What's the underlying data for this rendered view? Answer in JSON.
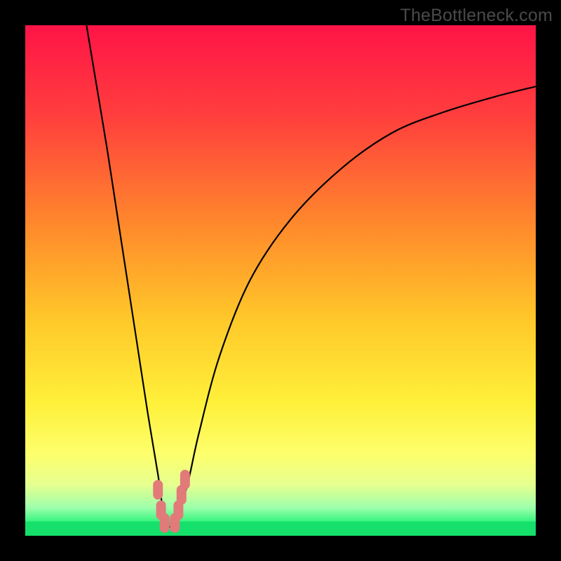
{
  "watermark": "TheBottleneck.com",
  "accent_colors": {
    "marker": "#e27a7a",
    "curve": "#000000",
    "green": "#14e06b"
  },
  "chart_data": {
    "type": "line",
    "title": "",
    "xlabel": "",
    "ylabel": "",
    "xlim": [
      0,
      100
    ],
    "ylim": [
      0,
      100
    ],
    "gradient_stops": [
      {
        "pos": 0.0,
        "color": "#ff1447"
      },
      {
        "pos": 0.18,
        "color": "#ff3f3d"
      },
      {
        "pos": 0.4,
        "color": "#ff8c2b"
      },
      {
        "pos": 0.58,
        "color": "#ffc92a"
      },
      {
        "pos": 0.74,
        "color": "#fff03a"
      },
      {
        "pos": 0.84,
        "color": "#fdff6c"
      },
      {
        "pos": 0.9,
        "color": "#e6ff8f"
      },
      {
        "pos": 0.945,
        "color": "#9dffab"
      },
      {
        "pos": 0.975,
        "color": "#2cf37a"
      },
      {
        "pos": 1.0,
        "color": "#0bd867"
      }
    ],
    "series": [
      {
        "name": "bottleneck-curve",
        "x": [
          12,
          14,
          16,
          18,
          20,
          22,
          24,
          26,
          27,
          28,
          29,
          30,
          32,
          34,
          38,
          44,
          52,
          62,
          72,
          82,
          92,
          100
        ],
        "y": [
          100,
          88,
          76,
          63,
          50,
          37,
          24,
          12,
          5,
          2,
          2,
          4,
          11,
          20,
          35,
          50,
          62,
          72,
          79,
          83,
          86,
          88
        ]
      }
    ],
    "markers": [
      {
        "x": 26.0,
        "y": 9.0
      },
      {
        "x": 26.6,
        "y": 5.0
      },
      {
        "x": 27.3,
        "y": 2.5
      },
      {
        "x": 29.3,
        "y": 2.5
      },
      {
        "x": 30.0,
        "y": 5.0
      },
      {
        "x": 30.6,
        "y": 8.0
      },
      {
        "x": 31.3,
        "y": 11.0
      }
    ]
  }
}
